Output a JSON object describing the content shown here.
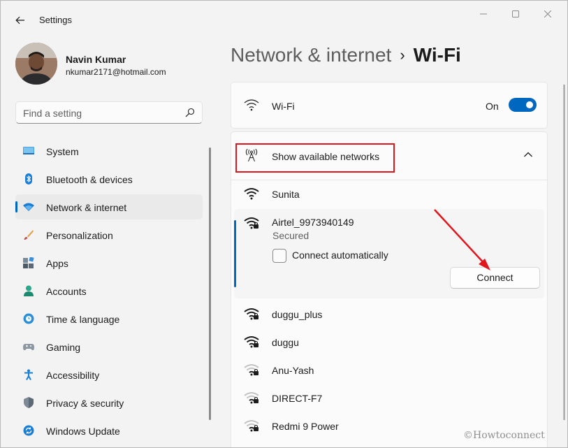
{
  "window": {
    "title": "Settings"
  },
  "profile": {
    "name": "Navin Kumar",
    "email": "nkumar2171@hotmail.com"
  },
  "search": {
    "placeholder": "Find a setting"
  },
  "nav": {
    "items": [
      {
        "label": "System",
        "icon": "system-icon",
        "active": false
      },
      {
        "label": "Bluetooth & devices",
        "icon": "bluetooth-icon",
        "active": false
      },
      {
        "label": "Network & internet",
        "icon": "network-icon",
        "active": true
      },
      {
        "label": "Personalization",
        "icon": "brush-icon",
        "active": false
      },
      {
        "label": "Apps",
        "icon": "apps-icon",
        "active": false
      },
      {
        "label": "Accounts",
        "icon": "accounts-icon",
        "active": false
      },
      {
        "label": "Time & language",
        "icon": "clock-globe-icon",
        "active": false
      },
      {
        "label": "Gaming",
        "icon": "gamepad-icon",
        "active": false
      },
      {
        "label": "Accessibility",
        "icon": "accessibility-icon",
        "active": false
      },
      {
        "label": "Privacy & security",
        "icon": "shield-icon",
        "active": false
      },
      {
        "label": "Windows Update",
        "icon": "update-icon",
        "active": false
      }
    ]
  },
  "breadcrumb": {
    "parent": "Network & internet",
    "separator": "›",
    "current": "Wi-Fi"
  },
  "wifi": {
    "label": "Wi-Fi",
    "state_label": "On",
    "enabled": true
  },
  "networks": {
    "header_label": "Show available networks",
    "expanded": true,
    "list": [
      {
        "ssid": "Sunita",
        "secured": false,
        "signal": "full"
      },
      {
        "ssid": "Airtel_9973940149",
        "secured": true,
        "signal": "full",
        "selected": true
      },
      {
        "ssid": "duggu_plus",
        "secured": true,
        "signal": "full"
      },
      {
        "ssid": "duggu",
        "secured": true,
        "signal": "full"
      },
      {
        "ssid": "Anu-Yash",
        "secured": true,
        "signal": "weak"
      },
      {
        "ssid": "DIRECT-F7",
        "secured": true,
        "signal": "weak"
      },
      {
        "ssid": "Redmi 9 Power",
        "secured": true,
        "signal": "weak"
      }
    ],
    "selected_details": {
      "status": "Secured",
      "auto_connect_label": "Connect automatically",
      "auto_connect_checked": false,
      "connect_button_label": "Connect"
    }
  },
  "colors": {
    "accent": "#0067c0",
    "annotation_red": "#e0161c"
  },
  "watermark": "©Howtoconnect"
}
